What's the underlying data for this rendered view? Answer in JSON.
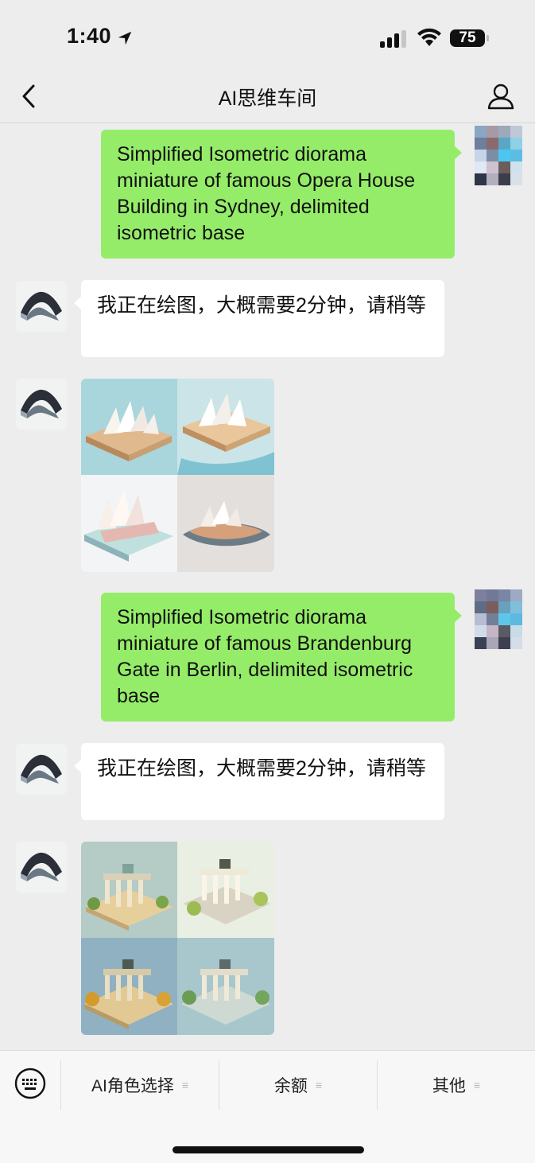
{
  "status_bar": {
    "time": "1:40",
    "battery": "75"
  },
  "nav": {
    "title": "AI思维车间"
  },
  "messages": [
    {
      "from": "me",
      "text": "Simplified Isometric diorama miniature of famous Opera House Building in Sydney, delimited isometric base"
    },
    {
      "from": "bot",
      "text": "我正在绘图，大概需要2分钟，请稍等"
    },
    {
      "from": "bot",
      "type": "image",
      "subject": "Sydney Opera House isometric dioramas (4 variants)"
    },
    {
      "from": "me",
      "text": "Simplified Isometric diorama miniature of famous Brandenburg Gate in Berlin, delimited isometric base"
    },
    {
      "from": "bot",
      "text": "我正在绘图，大概需要2分钟，请稍等"
    },
    {
      "from": "bot",
      "type": "image",
      "subject": "Brandenburg Gate isometric dioramas (4 variants)"
    }
  ],
  "bottom_menu": {
    "items": [
      {
        "label": "AI角色选择"
      },
      {
        "label": "余额"
      },
      {
        "label": "其他"
      }
    ],
    "menu_icon": "≡"
  },
  "colors": {
    "my_bubble": "#95ec69",
    "bot_bubble": "#ffffff",
    "background": "#ededed"
  }
}
